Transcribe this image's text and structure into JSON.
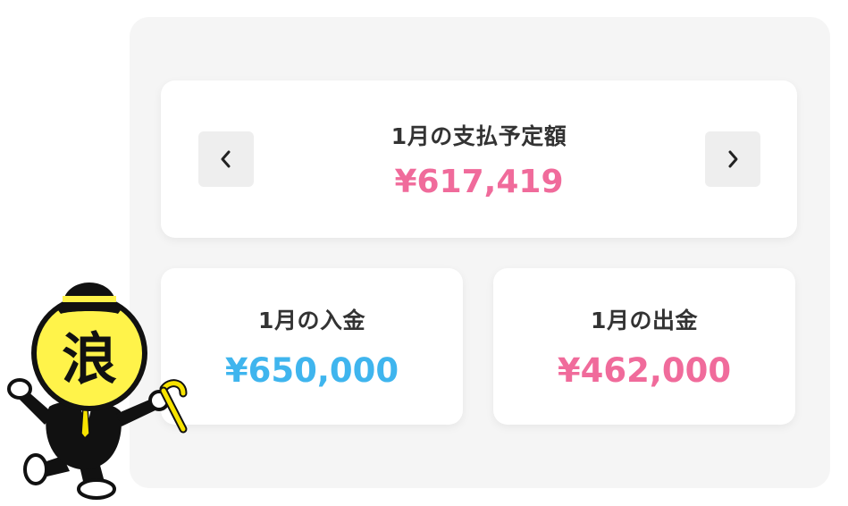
{
  "payment": {
    "label": "1月の支払予定額",
    "amount": "¥617,419",
    "amount_color": "#f06b9b"
  },
  "income": {
    "label": "1月の入金",
    "amount": "¥650,000",
    "amount_color": "#3fb5ee"
  },
  "expense": {
    "label": "1月の出金",
    "amount": "¥462,000",
    "amount_color": "#f06b9b"
  },
  "nav": {
    "prev_icon": "chevron-left-icon",
    "next_icon": "chevron-right-icon"
  },
  "mascot": {
    "icon": "mascot-character",
    "face_text": "浪",
    "face_color": "#fff34a"
  }
}
